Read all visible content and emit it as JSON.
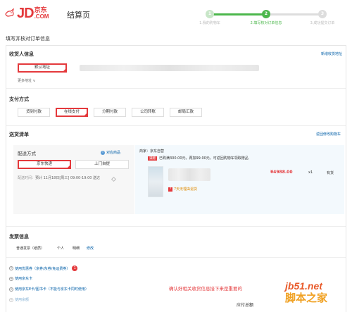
{
  "header": {
    "logo_jd": "JD",
    "logo_cn": "京东",
    "logo_com": ".COM",
    "page_title": "结算页",
    "steps": [
      {
        "num": "1",
        "label": "1.我的购物车"
      },
      {
        "num": "2",
        "label": "2.填写核对订单信息"
      },
      {
        "num": "3",
        "label": "3.成功提交订单"
      }
    ]
  },
  "fill_title": "填写并核对订单信息",
  "receiver": {
    "title": "收货人信息",
    "add_link": "新增收货地址",
    "default_addr": "默认地址",
    "more_addr": "更多地址 ∨"
  },
  "payment": {
    "title": "支付方式",
    "options": [
      "货到付款",
      "在线支付",
      "分期付款",
      "公司转账",
      "邮局汇款"
    ],
    "selected": "在线支付"
  },
  "delivery": {
    "title": "送货清单",
    "back_link": "返回修改购物车",
    "method_title": "配送方式",
    "compare_link": "对应商品",
    "options": [
      "京东快递",
      "上门自提"
    ],
    "time_label": "配送时间：",
    "time_value": "预计 11月18日[周三] 09:00-19:00 送达",
    "merchant": "商家：京东自营",
    "promo_tag": "满赠",
    "promo_text": "已购满300.00元，再加99.00元，可返回购物车领取赠品",
    "price": "¥4988.00",
    "qty": "x1",
    "stock": "有货",
    "return_label": "7天无理由退货"
  },
  "invoice": {
    "title": "发票信息",
    "type": "普通发票（纸质）",
    "header": "个人",
    "detail": "明细",
    "modify": "修改"
  },
  "coupons": [
    {
      "label": "使用优惠券（京券/东券/免运费券）",
      "badge": "1"
    },
    {
      "label": "使用京东卡"
    },
    {
      "label": "使用京东E卡/图书卡（不能与京东卡同时使用）"
    },
    {
      "label": "使用余额"
    }
  ],
  "annotation": "确认好相关收货信息接下来是重要的",
  "watermark": {
    "url": "jb51.net",
    "cn": "脚本之家"
  },
  "total_label": "应付总额"
}
